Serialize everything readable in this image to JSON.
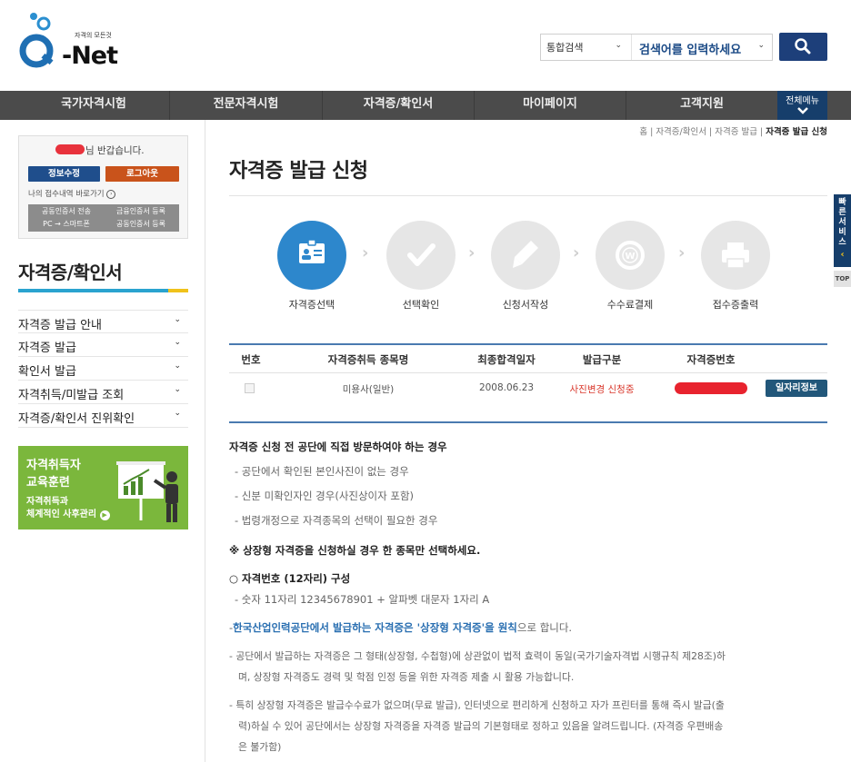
{
  "header": {
    "logo_tagline": "자격의 모든것",
    "logo_word": "-Net",
    "search_select": "통합검색",
    "search_placeholder": "검색어를 입력하세요"
  },
  "gnb": {
    "items": [
      "국가자격시험",
      "전문자격시험",
      "자격증/확인서",
      "마이페이지",
      "고객지원"
    ],
    "all_menu": "전체메뉴"
  },
  "login_box": {
    "greeting": "님 반갑습니다.",
    "edit_info": "정보수정",
    "logout": "로그아웃",
    "my_history": "나의 접수내역 바로가기",
    "cert_transfer_1": "공동인증서 전송",
    "cert_transfer_2": "PC → 스마트폰",
    "cert_register_1": "금융인증서 등록",
    "cert_register_2": "공동인증서 등록"
  },
  "left_nav": {
    "title": "자격증/확인서",
    "items": [
      "자격증 발급 안내",
      "자격증 발급",
      "확인서 발급",
      "자격취득/미발급 조회",
      "자격증/확인서 진위확인"
    ]
  },
  "banner": {
    "line1": "자격취득자",
    "line2": "교육훈련",
    "line3": "자격취득과",
    "line4": "체계적인 사후관리"
  },
  "breadcrumb": {
    "home": "홈",
    "level1": "자격증/확인서",
    "level2": "자격증 발급",
    "current": "자격증 발급 신청"
  },
  "page": {
    "title": "자격증 발급 신청"
  },
  "steps": [
    {
      "label": "자격증선택",
      "icon": "id-card-icon",
      "active": true
    },
    {
      "label": "선택확인",
      "icon": "check-icon",
      "active": false
    },
    {
      "label": "신청서작성",
      "icon": "pencil-icon",
      "active": false
    },
    {
      "label": "수수료결제",
      "icon": "won-coin-icon",
      "active": false
    },
    {
      "label": "접수증출력",
      "icon": "printer-icon",
      "active": false
    }
  ],
  "table": {
    "headers": [
      "번호",
      "자격증취득 종목명",
      "최종합격일자",
      "발급구분",
      "자격증번호"
    ],
    "row": {
      "name": "미용사(일반)",
      "date": "2008.06.23",
      "status": "사진변경 신청중",
      "job_button": "일자리정보"
    }
  },
  "notes": {
    "visit_title": "자격증 신청 전 공단에 직접 방문하여야 하는 경우",
    "visit_items": [
      "- 공단에서 확인된 본인사진이 없는 경우",
      "- 신분 미확인자인 경우(사진상이자 포함)",
      "- 법령개정으로 자격종목의 선택이 필요한 경우"
    ],
    "warning": "※ 상장형 자격증을 신청하실 경우 한 종목만 선택하세요.",
    "number_title": "○ 자격번호 (12자리) 구성",
    "number_desc": "- 숫자 11자리 12345678901 + 알파벳 대문자 1자리 A",
    "principle_prefix": "-",
    "principle_blue": "한국산업인력공단에서 발급하는 자격증은 '상장형 자격증'을 원칙",
    "principle_suffix": "으로 합니다.",
    "p2_line1": "- 공단에서 발급하는 자격증은 그 형태(상장형, 수첩형)에 상관없이 법적 효력이 동일(국가기술자격법 시행규칙 제28조)하",
    "p2_line2": "며, 상장형 자격증도 경력 및 학점 인정 등을 위한 자격증 제출 시 활용 가능합니다.",
    "p3_line1": "- 특히 상장형 자격증은 발급수수료가 없으며(무료 발급), 인터넷으로 편리하게 신청하고 자가 프린터를 통해 즉시 발급(출",
    "p3_line2": "력)하실 수 있어 공단에서는 상장형 자격증을 자격증 발급의 기본형태로 정하고 있음을 알려드립니다. (자격증 우편배송",
    "p3_line3": "은 불가함)"
  },
  "quick": {
    "label": "빠른서비스",
    "top": "TOP"
  },
  "colors": {
    "brand_blue": "#1d3f7a",
    "active_step": "#2d87cc",
    "status_red": "#d9382c",
    "gnb_bg": "#4b4b4b",
    "banner_green": "#7bb73c"
  }
}
